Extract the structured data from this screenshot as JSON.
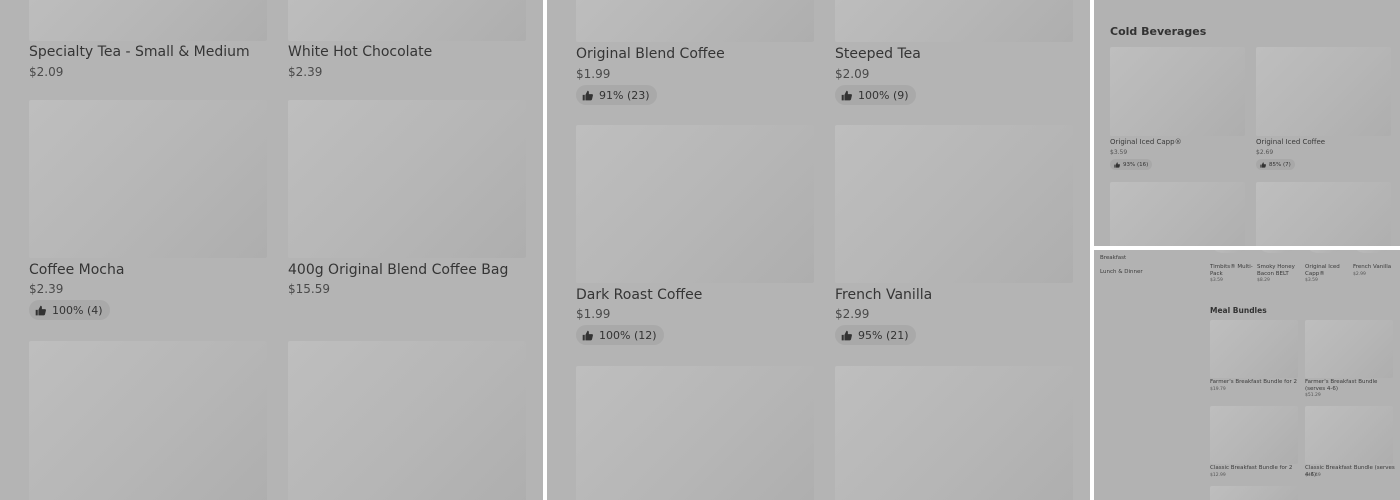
{
  "panel1": {
    "items": [
      {
        "name": "Specialty Tea - Small & Medium",
        "price": "$2.09"
      },
      {
        "name": "White Hot Chocolate",
        "price": "$2.39"
      },
      {
        "name": "Coffee Mocha",
        "price": "$2.39",
        "rating": "100% (4)"
      },
      {
        "name": "400g Original Blend Coffee Bag",
        "price": "$15.59"
      }
    ]
  },
  "panel2": {
    "items": [
      {
        "name": "Original Blend Coffee",
        "price": "$1.99",
        "rating": "91% (23)"
      },
      {
        "name": "Steeped Tea",
        "price": "$2.09",
        "rating": "100% (9)"
      },
      {
        "name": "Dark Roast Coffee",
        "price": "$1.99",
        "rating": "100% (12)"
      },
      {
        "name": "French Vanilla",
        "price": "$2.99",
        "rating": "95% (21)"
      }
    ]
  },
  "panel3": {
    "section_title": "Cold Beverages",
    "items": [
      {
        "name": "Original Iced Capp®",
        "price": "$3.59",
        "rating": "93% (16)"
      },
      {
        "name": "Original Iced Coffee",
        "price": "$2.69",
        "rating": "85% (7)"
      }
    ]
  },
  "panel4": {
    "sidebar": [
      "Breakfast",
      "Lunch & Dinner"
    ],
    "top_items": [
      {
        "name": "Timbits® Multi-Pack",
        "price": "$3.59"
      },
      {
        "name": "Smoky Honey Bacon BELT",
        "price": "$8.29"
      },
      {
        "name": "Original Iced Capp®",
        "price": "$3.59"
      },
      {
        "name": "French Vanilla",
        "price": "$2.99"
      }
    ],
    "section_title": "Meal Bundles",
    "bundles": [
      {
        "name": "Farmer's Breakfast Bundle for 2",
        "price": "$19.79"
      },
      {
        "name": "Farmer's Breakfast Bundle (serves 4-6)",
        "price": "$51.29"
      },
      {
        "name": "Classic Breakfast Bundle for 2",
        "price": "$12.99"
      },
      {
        "name": "Classic Breakfast Bundle (serves 4-6)",
        "price": "$47.49"
      }
    ]
  },
  "icons": {
    "rating": "thumbs-up-icon"
  },
  "colors": {
    "overlay": "#b4b4b4",
    "placeholder": "#bcbcbc",
    "divider": "#ffffff"
  }
}
